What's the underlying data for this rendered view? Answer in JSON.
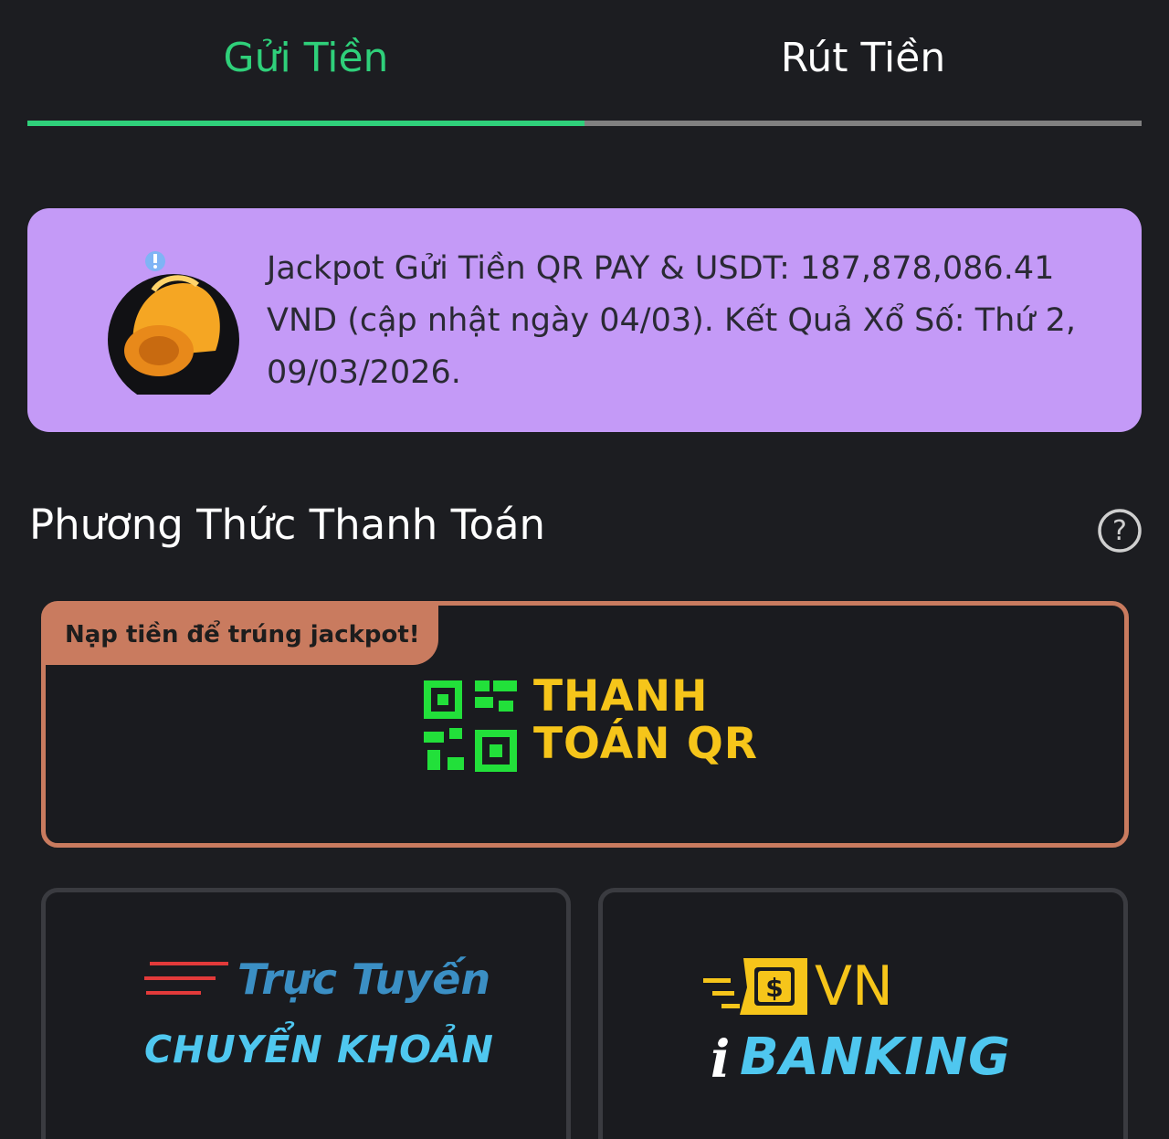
{
  "tabs": {
    "deposit_label": "Gửi Tiền",
    "withdraw_label": "Rút Tiền",
    "active": "deposit",
    "active_color": "#2fd07a"
  },
  "notice": {
    "icon": "bell-icon",
    "text": "Jackpot Gửi Tiền QR PAY & USDT: 187,878,086.41 VND (cập nhật ngày 04/03). Kết Quả Xổ Số: Thứ 2, 09/03/2026.",
    "background": "#c49af7"
  },
  "payment_section": {
    "title": "Phương Thức Thanh Toán",
    "help_icon": "question-circle-icon"
  },
  "methods": {
    "qr": {
      "badge": "Nạp tiền để trúng jackpot!",
      "label_line1": "THANH",
      "label_line2": "TOÁN QR",
      "icon": "qr-code-icon",
      "border_color": "#c97b5f"
    },
    "online": {
      "label_top": "Trực Tuyến",
      "label_bottom": "CHUYỂN KHOẢN",
      "icon": "speed-lines-icon"
    },
    "ibanking": {
      "label_vn": "VN",
      "label_i": "i",
      "label_banking": "BANKING",
      "icon": "dollar-wallet-icon"
    }
  }
}
